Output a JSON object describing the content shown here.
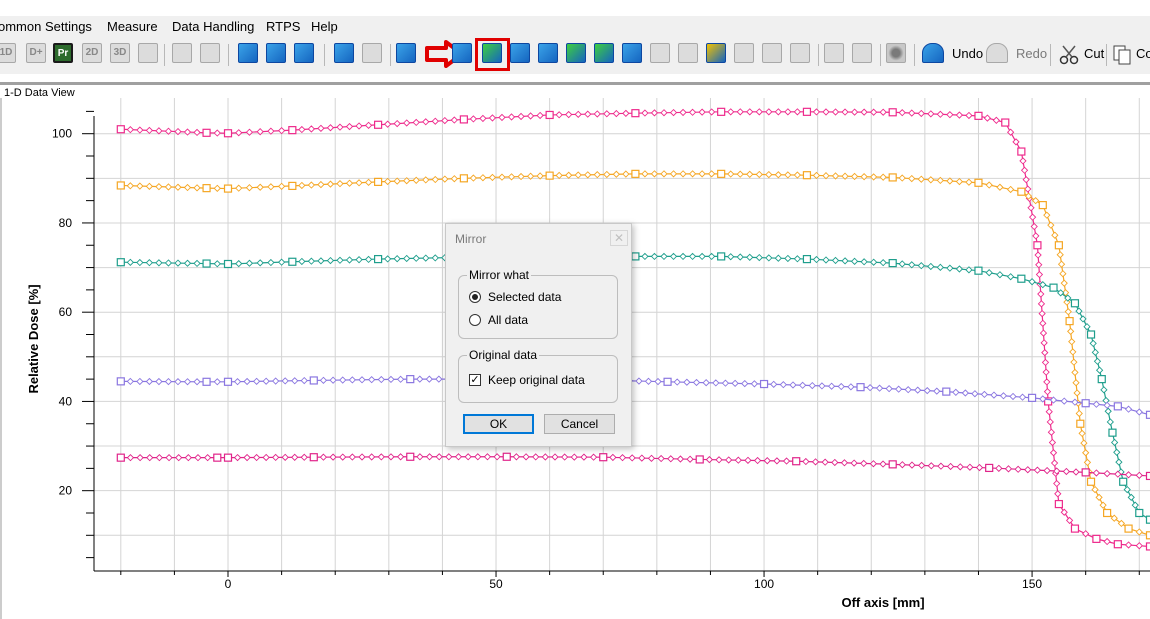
{
  "menu": {
    "items": [
      "ommon Settings",
      "Measure",
      "Data Handling",
      "RTPS",
      "Help"
    ]
  },
  "toolbar": {
    "mode_labels": [
      "1D",
      "D+",
      "Pr",
      "2D",
      "3D"
    ],
    "undo_label": "Undo",
    "redo_label": "Redo",
    "cut_label": "Cut",
    "copy_label": "Co",
    "highlight_color": "#e00000",
    "arrow_icon": "right-arrow-icon"
  },
  "view": {
    "label": "1-D Data View"
  },
  "chart_data": {
    "type": "line",
    "xlabel": "Off axis [mm]",
    "ylabel": "Relative Dose [%]",
    "xlim": [
      -25,
      172
    ],
    "ylim": [
      2,
      108
    ],
    "xticks": [
      0,
      50,
      100,
      150
    ],
    "yticks": [
      20,
      40,
      60,
      80,
      100
    ],
    "grid": true,
    "legend": "none",
    "series": [
      {
        "color": "#ee2a8c",
        "points": [
          [
            -20,
            101.0
          ],
          [
            -4,
            100.2
          ],
          [
            0,
            100.1
          ],
          [
            12,
            100.8
          ],
          [
            28,
            102.0
          ],
          [
            44,
            103.2
          ],
          [
            60,
            104.2
          ],
          [
            76,
            104.6
          ],
          [
            92,
            104.9
          ],
          [
            108,
            104.9
          ],
          [
            124,
            104.8
          ],
          [
            140,
            104.0
          ],
          [
            145,
            102.5
          ],
          [
            148,
            96
          ],
          [
            151,
            75
          ],
          [
            153,
            40
          ],
          [
            155,
            17
          ],
          [
            158,
            11.5
          ],
          [
            162,
            9.2
          ],
          [
            166,
            8.0
          ],
          [
            172,
            7.5
          ]
        ]
      },
      {
        "color": "#f5a623",
        "points": [
          [
            -20,
            88.4
          ],
          [
            -4,
            87.8
          ],
          [
            0,
            87.7
          ],
          [
            12,
            88.3
          ],
          [
            28,
            89.2
          ],
          [
            44,
            90.0
          ],
          [
            60,
            90.6
          ],
          [
            76,
            91.0
          ],
          [
            92,
            91.0
          ],
          [
            108,
            90.7
          ],
          [
            124,
            90.2
          ],
          [
            140,
            89.0
          ],
          [
            148,
            87.0
          ],
          [
            152,
            84
          ],
          [
            155,
            75
          ],
          [
            157,
            58
          ],
          [
            159,
            35
          ],
          [
            161,
            22
          ],
          [
            164,
            15
          ],
          [
            168,
            11.5
          ],
          [
            172,
            10.0
          ]
        ]
      },
      {
        "color": "#1e9e8c",
        "points": [
          [
            -20,
            71.2
          ],
          [
            -4,
            70.9
          ],
          [
            0,
            70.8
          ],
          [
            12,
            71.3
          ],
          [
            28,
            71.9
          ],
          [
            44,
            72.3
          ],
          [
            60,
            72.6
          ],
          [
            76,
            72.5
          ],
          [
            92,
            72.5
          ],
          [
            108,
            71.9
          ],
          [
            124,
            71.0
          ],
          [
            140,
            69.3
          ],
          [
            148,
            67.5
          ],
          [
            154,
            65.5
          ],
          [
            158,
            62
          ],
          [
            161,
            55
          ],
          [
            163,
            45
          ],
          [
            165,
            33
          ],
          [
            167,
            22
          ],
          [
            170,
            15
          ],
          [
            172,
            13.5
          ]
        ]
      },
      {
        "color": "#8a76e0",
        "points": [
          [
            -20,
            44.5
          ],
          [
            -4,
            44.4
          ],
          [
            0,
            44.4
          ],
          [
            16,
            44.7
          ],
          [
            34,
            45.0
          ],
          [
            50,
            45.0
          ],
          [
            66,
            44.9
          ],
          [
            82,
            44.4
          ],
          [
            100,
            43.9
          ],
          [
            118,
            43.2
          ],
          [
            134,
            42.2
          ],
          [
            150,
            40.8
          ],
          [
            160,
            39.6
          ],
          [
            166,
            38.9
          ],
          [
            172,
            37.0
          ]
        ]
      },
      {
        "color": "#e0248a",
        "points": [
          [
            -20,
            27.4
          ],
          [
            -2,
            27.4
          ],
          [
            0,
            27.4
          ],
          [
            16,
            27.5
          ],
          [
            34,
            27.6
          ],
          [
            52,
            27.6
          ],
          [
            70,
            27.5
          ],
          [
            88,
            27.0
          ],
          [
            106,
            26.6
          ],
          [
            124,
            25.9
          ],
          [
            142,
            25.1
          ],
          [
            160,
            24.1
          ],
          [
            172,
            23.3
          ]
        ]
      }
    ]
  },
  "dialog": {
    "title": "Mirror",
    "close_icon": "close-icon",
    "group1_label": "Mirror what",
    "option_selected": "Selected data",
    "option_all": "All data",
    "group2_label": "Original data",
    "keep_label": "Keep original data",
    "keep_checked": true,
    "ok_label": "OK",
    "cancel_label": "Cancel"
  }
}
